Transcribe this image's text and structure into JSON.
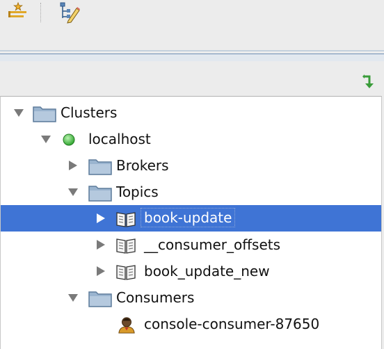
{
  "toolbar": {
    "buttons": [
      {
        "icon": "add-config-icon"
      },
      {
        "icon": "edit-tree-icon"
      }
    ]
  },
  "tree": {
    "refresh_icon": "refresh-arrow-icon",
    "nodes": [
      {
        "label": "Clusters",
        "level": 0,
        "expanded": true,
        "icon": "folder-icon"
      },
      {
        "label": "localhost",
        "level": 1,
        "expanded": true,
        "icon": "status-green-icon"
      },
      {
        "label": "Brokers",
        "level": 2,
        "expanded": false,
        "icon": "folder-icon"
      },
      {
        "label": "Topics",
        "level": 2,
        "expanded": true,
        "icon": "folder-icon"
      },
      {
        "label": "book-update",
        "level": 3,
        "expanded": false,
        "icon": "book-icon",
        "selected": true
      },
      {
        "label": "__consumer_offsets",
        "level": 3,
        "expanded": false,
        "icon": "book-icon"
      },
      {
        "label": "book_update_new",
        "level": 3,
        "expanded": false,
        "icon": "book-icon"
      },
      {
        "label": "Consumers",
        "level": 2,
        "expanded": true,
        "icon": "folder-icon"
      },
      {
        "label": "console-consumer-87650",
        "level": 3,
        "icon": "consumer-icon"
      }
    ]
  },
  "colors": {
    "selection": "#3f74d5",
    "folder": "#9ab4cf",
    "status_online": "#3ec43e"
  }
}
